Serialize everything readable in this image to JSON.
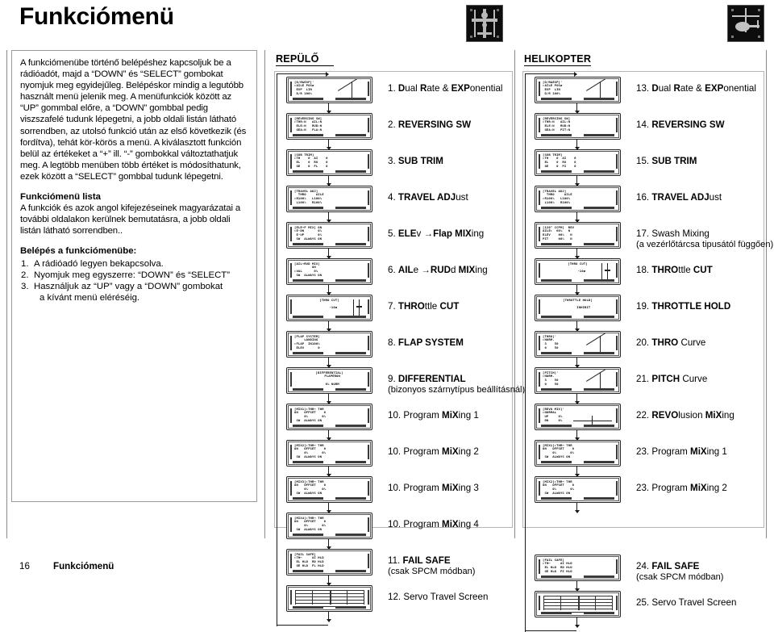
{
  "header": {
    "title": "Funkciómenü",
    "thumb_plane_alt": "airplane-photo",
    "thumb_heli_alt": "helicopter-photo"
  },
  "left": {
    "intro": "A funkciómenübe történő belépéshez kapcsoljuk be a rádióadót, majd a “DOWN” és “SELECT” gombokat nyomjuk  meg egyidejűleg. Belépéskor mindig a legutóbb használt menü jelenik meg. A menüfunkciók között az “UP” gommbal előre, a “DOWN” gombbal pedig viszszafelé tudunk lépegetni, a jobb oldali listán látható sorrendben, az utolsó funkció után az első következik (és fordítva), tehát kör-körös a menü. A kiválasztott funkción belül az értékeket a “+” ill. “-” gombokkal változtathatjuk meg. A legtöbb menüben több értéket is módosíthatunk, ezek között a “SELECT” gombbal tudunk lépegetni.",
    "list_heading": "Funkciómenü lista",
    "list_body": "A funkciók és azok angol kifejezéseinek magyarázatai a további oldalakon kerülnek bemutatásra, a jobb oldali listán látható sorrendben..",
    "steps_heading": "Belépés a funkciómenübe:",
    "steps": [
      {
        "num": "1.",
        "text": "A rádióadó legyen bekapcsolva."
      },
      {
        "num": "2.",
        "text": "Nyomjuk meg egyszerre:  “DOWN” és “SELECT”"
      },
      {
        "num": "3.",
        "text": "Használjuk az “UP” vagy a “DOWN” gombokat",
        "text2": "a kívánt menü eléréséig."
      }
    ]
  },
  "plane": {
    "heading": "REPÜLŐ",
    "items": [
      {
        "index": "1.",
        "bold1": "D",
        "norm1": "ual ",
        "bold2": "R",
        "norm2": "ate & ",
        "bold3": "EXP",
        "norm3": "onential",
        "lcd": {
          "l1": "[D/R&EXP]'",
          "l2": "▸AILE POSø",
          "l3": " EXP  LIN",
          "l4": " D/R 100%",
          "graphic": "curve-up",
          "align": "left"
        }
      },
      {
        "index": "2.",
        "bold1": "REVERSING SW",
        "lcd": {
          "l1": "[REVERSING SW]",
          "l2": "▸THR:N   AIL:N",
          "l3": " ELE:N   RUD:N",
          "l4": " GEA:N   FLA:N",
          "align": "left"
        }
      },
      {
        "index": "3.",
        "bold1": "SUB TRIM",
        "lcd": {
          "l1": "[SUB TRIM]",
          "l2": "▸TH    0  AI    0",
          "l3": " EL    0  RU    0",
          "l4": " GE    0  FL    0",
          "align": "left"
        }
      },
      {
        "index": "4.",
        "bold1": "TRAVEL ADJ",
        "norm1": "ust",
        "lcd": {
          "l1": "[TRAVEL ADJ]",
          "l2": "  THRO     AILE",
          "l3": "▸R100%   L100%",
          "l4": " L100%   R100%",
          "align": "left"
        }
      },
      {
        "index": "5.",
        "bold1": "ELE",
        "norm1": "v ",
        "arrow": "→",
        "bold2": "Flap ",
        "norm2": "",
        "bold3": "MIX",
        "norm3": "ing",
        "lcd": {
          "l1": "[ELE→F MIX] ON",
          "l2": "▸E-DN       0%",
          "l3": " E-UP       0%",
          "l4": " SW  ALWAYS ON",
          "align": "left"
        }
      },
      {
        "index": "6.",
        "bold1": "AIL",
        "norm1": "e ",
        "arrow": "→",
        "bold2": "RUD",
        "norm2": "d ",
        "bold3": "MIX",
        "norm3": "ing",
        "lcd": {
          "l1": "[AIL→RUD MIX]",
          "l2": "         ON",
          "l3": "▸VAL      0%",
          "l4": " SW  ALWAYS ON",
          "align": "left"
        }
      },
      {
        "index": "7.",
        "bold1": "THRO",
        "norm1": "ttle ",
        "bold2": "CUT",
        "lcd": {
          "l1": "[THRO CUT]",
          "l2": "",
          "l3": "    -10ø",
          "l4": "",
          "graphic": "slider",
          "align": "center"
        }
      },
      {
        "index": "8.",
        "bold1": "FLAP SYSTEM",
        "lcd": {
          "l1": "[FLAP SYSTEM]",
          "l2": "     LANDING",
          "l3": "▸FLAP  IN100%",
          "l4": " ELEV       0",
          "align": "left"
        }
      },
      {
        "index": "9.",
        "bold1": "DIFFERENTIAL",
        "sub": "(bizonyos szárnytípus beállításnál)",
        "lcd": {
          "l1": "[DIFFERENTIAL]",
          "l2": "   FLAPERON",
          "l3": "",
          "l4": "   0% NORM",
          "align": "center"
        }
      },
      {
        "index": "10.",
        "norm1": "Program ",
        "bold2": "MiX",
        "norm2": "ing 1",
        "lcd": {
          "l1": "[MIX1]▸THR→ THR",
          "l2": "ON   OFFSET    0",
          "l3": "     0%       0%",
          "l4": " SW  ALWAYS ON",
          "align": "left"
        }
      },
      {
        "index": "10.",
        "norm1": "Program ",
        "bold2": "MiX",
        "norm2": "ing 2",
        "lcd": {
          "l1": "[MIX2]▸THR→ THR",
          "l2": "ON   OFFSET    0",
          "l3": "     0%       0%",
          "l4": " SW  ALWAYS ON",
          "align": "left"
        }
      },
      {
        "index": "10.",
        "norm1": "Program ",
        "bold2": "MiX",
        "norm2": "ing 3",
        "lcd": {
          "l1": "[MIX3]▸THR→ THR",
          "l2": "ON   OFFSET    0",
          "l3": "     0%       0%",
          "l4": " SW  ALWAYS ON",
          "align": "left"
        }
      },
      {
        "index": "10.",
        "norm1": "Program ",
        "bold2": "MiX",
        "norm2": "ing 4",
        "lcd": {
          "l1": "[MIX4]▸THR→ THR",
          "l2": "ON   OFFSET    0",
          "l3": "     0%       0%",
          "l4": " SW  ALWAYS ON",
          "align": "left"
        }
      },
      {
        "index": "11.",
        "bold1": "FAIL SAFE",
        "sub": "(csak SPCM módban)",
        "lcd": {
          "l1": "[FAIL SAFE]",
          "l2": "▸TH←     AI HLD",
          "l3": " EL HLD  RD HLD",
          "l4": " GE HLD  FL HLD",
          "align": "left"
        }
      },
      {
        "index": "12.",
        "norm1": "Servo Travel Screen",
        "lcd": {
          "graphic": "servo",
          "align": "center"
        }
      }
    ]
  },
  "heli": {
    "heading": "HELIKOPTER",
    "items": [
      {
        "index": "13.",
        "bold1": "D",
        "norm1": "ual ",
        "bold2": "R",
        "norm2": "ate & ",
        "bold3": "EXP",
        "norm3": "onential",
        "lcd": {
          "l1": "[D/R&EXP]'",
          "l2": "▸AILE POSø",
          "l3": " EXP  LIN",
          "l4": " D/R 100%",
          "graphic": "curve-up",
          "align": "left"
        }
      },
      {
        "index": "14.",
        "bold1": "REVERSING SW",
        "lcd": {
          "l1": "[REVERSING SW]",
          "l2": "▸THR:N   AIL:N",
          "l3": " ELE:N   RUD:N",
          "l4": " GEA:N   PIT:N",
          "align": "left"
        }
      },
      {
        "index": "15.",
        "bold1": "SUB TRIM",
        "lcd": {
          "l1": "[SUB TRIM]",
          "l2": "▸TH    0  AI    0",
          "l3": " EL    0  RU    0",
          "l4": " GE    0  PI    0",
          "align": "left"
        }
      },
      {
        "index": "16.",
        "bold1": "TRAVEL ADJ",
        "norm1": "ust",
        "lcd": {
          "l1": "[TRAVEL ADJ]",
          "l2": "  THRO     AILE",
          "l3": "▸R100%   L100%",
          "l4": " L100%   R100%",
          "align": "left"
        }
      },
      {
        "index": "17.",
        "norm1": "Swash Mixing",
        "sub": "(a vezérlőtárcsa tipusától függően)",
        "lcd": {
          "l1": "[120° CCPM]  REV",
          "l2": "AILE▸  60%   N",
          "l3": "ELEV    60%   N",
          "l4": "PIT     60%   N",
          "align": "left"
        }
      },
      {
        "index": "18.",
        "bold1": "THRO",
        "norm1": "ttle ",
        "bold2": "CUT",
        "lcd": {
          "l1": "[THRO CUT]",
          "l2": "",
          "l3": "    -10ø",
          "l4": "",
          "graphic": "slider",
          "align": "center"
        }
      },
      {
        "index": "19.",
        "bold1": "THROTTLE HOLD",
        "lcd": {
          "l1": "[THROTTLE HOLD]",
          "l2": "",
          "l3": "      INHIBIT",
          "l4": "",
          "align": "center"
        }
      },
      {
        "index": "20.",
        "bold1": "THRO",
        "norm1": " Curve",
        "lcd": {
          "l1": "[THRO]'",
          "l2": "▸NORM.",
          "l3": " 3    50",
          "l4": " 0    50",
          "graphic": "curve-up",
          "align": "left"
        }
      },
      {
        "index": "21.",
        "bold1": "PITCH",
        "norm1": " Curve",
        "lcd": {
          "l1": "[PITCH]'",
          "l2": "▸NORM.",
          "l3": " 3    50",
          "l4": " 0    50",
          "graphic": "curve-up",
          "align": "left"
        }
      },
      {
        "index": "22.",
        "bold1": "REVO",
        "norm1": "lusion ",
        "bold2": "MiX",
        "norm2": "ing",
        "lcd": {
          "l1": "[REVO MIX]'",
          "l2": "▸NORMAL",
          "l3": " UP     0%",
          "l4": " DN     0%",
          "graphic": "flatline",
          "align": "left"
        }
      },
      {
        "index": "23.",
        "norm1": "Program ",
        "bold2": "MiX",
        "norm2": "ing 1",
        "lcd": {
          "l1": "[MIX1]▸THR→ THR",
          "l2": "ON   OFFSET    0",
          "l3": "     0%       0%",
          "l4": " SW  ALWAYS ON",
          "align": "left"
        }
      },
      {
        "index": "23.",
        "norm1": "Program ",
        "bold2": "MiX",
        "norm2": "ing 2",
        "lcd": {
          "l1": "[MIX2]▸THR→ THR",
          "l2": "ON   OFFSET    0",
          "l3": "     0%       0%",
          "l4": " SW  ALWAYS ON",
          "align": "left"
        }
      },
      {
        "index": "24.",
        "bold1": "FAIL SAFE",
        "sub": "(csak SPCM módban)",
        "gap": true,
        "lcd": {
          "l1": "[FAIL SAFE]",
          "l2": "▸TH←     AI HLD",
          "l3": " EL HLD  RD HLD",
          "l4": " GE HLD  PI HLD",
          "align": "left"
        }
      },
      {
        "index": "25.",
        "norm1": "Servo Travel Screen",
        "lcd": {
          "graphic": "servo",
          "align": "center"
        }
      }
    ]
  },
  "footer": {
    "page_number": "16",
    "title": "Funkciómenü"
  }
}
